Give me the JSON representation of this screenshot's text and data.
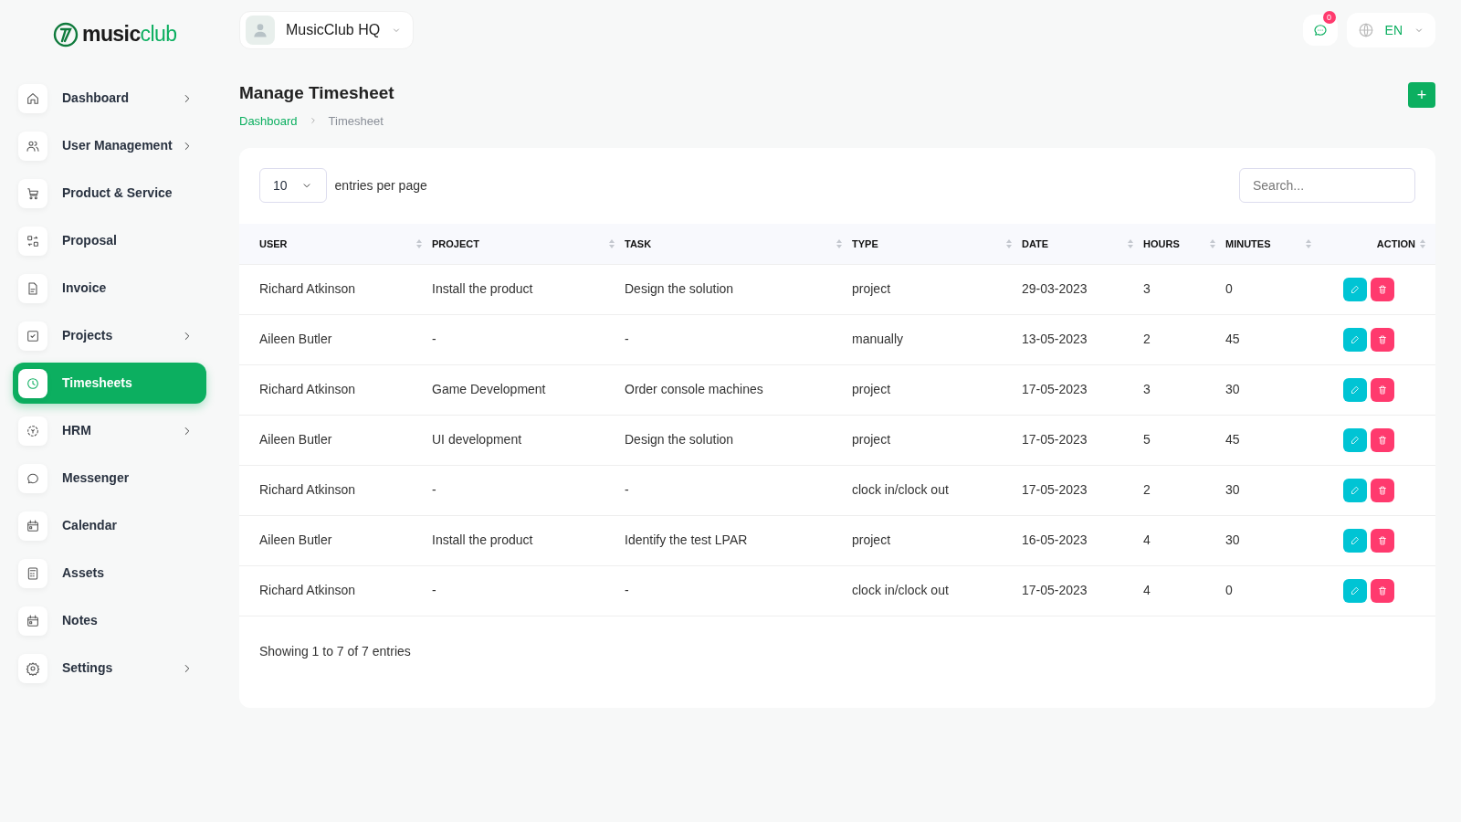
{
  "logo": {
    "strong": "music",
    "light": "club"
  },
  "workspace": {
    "name": "MusicClub HQ"
  },
  "header": {
    "notifications": "0",
    "language": "EN"
  },
  "sidebar": {
    "items": [
      {
        "label": "Dashboard",
        "expandable": true,
        "selected": false
      },
      {
        "label": "User Management",
        "expandable": true,
        "selected": false
      },
      {
        "label": "Product & Service",
        "expandable": false,
        "selected": false
      },
      {
        "label": "Proposal",
        "expandable": false,
        "selected": false
      },
      {
        "label": "Invoice",
        "expandable": false,
        "selected": false
      },
      {
        "label": "Projects",
        "expandable": true,
        "selected": false
      },
      {
        "label": "Timesheets",
        "expandable": false,
        "selected": true
      },
      {
        "label": "HRM",
        "expandable": true,
        "selected": false
      },
      {
        "label": "Messenger",
        "expandable": false,
        "selected": false
      },
      {
        "label": "Calendar",
        "expandable": false,
        "selected": false
      },
      {
        "label": "Assets",
        "expandable": false,
        "selected": false
      },
      {
        "label": "Notes",
        "expandable": false,
        "selected": false
      },
      {
        "label": "Settings",
        "expandable": true,
        "selected": false
      }
    ]
  },
  "page": {
    "title": "Manage Timesheet",
    "breadcrumb": [
      "Dashboard",
      "Timesheet"
    ],
    "add_button": "+"
  },
  "table": {
    "page_size": "10",
    "page_size_label": "entries per page",
    "search_placeholder": "Search...",
    "columns": [
      "USER",
      "PROJECT",
      "TASK",
      "TYPE",
      "DATE",
      "HOURS",
      "MINUTES",
      "ACTION"
    ],
    "rows": [
      [
        "Richard Atkinson",
        "Install the product",
        "Design the solution",
        "project",
        "29-03-2023",
        "3",
        "0"
      ],
      [
        "Aileen Butler",
        "-",
        "-",
        "manually",
        "13-05-2023",
        "2",
        "45"
      ],
      [
        "Richard Atkinson",
        "Game Development",
        "Order console machines",
        "project",
        "17-05-2023",
        "3",
        "30"
      ],
      [
        "Aileen Butler",
        "UI development",
        "Design the solution",
        "project",
        "17-05-2023",
        "5",
        "45"
      ],
      [
        "Richard Atkinson",
        "-",
        "-",
        "clock in/clock out",
        "17-05-2023",
        "2",
        "30"
      ],
      [
        "Aileen Butler",
        "Install the product",
        "Identify the test LPAR",
        "project",
        "16-05-2023",
        "4",
        "30"
      ],
      [
        "Richard Atkinson",
        "-",
        "-",
        "clock in/clock out",
        "17-05-2023",
        "4",
        "0"
      ]
    ],
    "footer": "Showing 1 to 7 of 7 entries"
  }
}
